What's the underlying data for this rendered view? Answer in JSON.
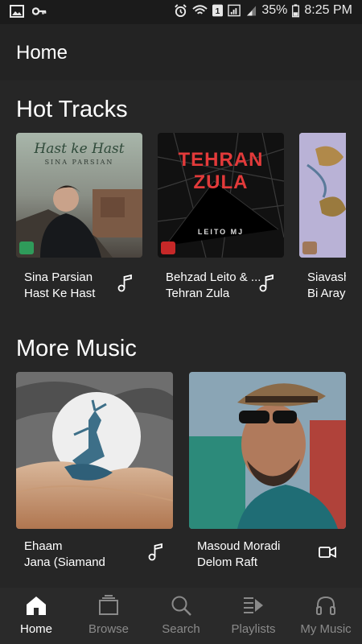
{
  "status_bar": {
    "battery": "35%",
    "time": "8:25 PM"
  },
  "appbar": {
    "title": "Home"
  },
  "sections": {
    "hot_tracks": {
      "title": "Hot Tracks",
      "items": [
        {
          "artist": "Sina Parsian",
          "track": "Hast Ke Hast",
          "art_text": "Hast ke Hast",
          "art_sub": "SINA PARSIAN",
          "type": "music-note-icon"
        },
        {
          "artist": "Behzad Leito & ...",
          "track": "Tehran Zula",
          "art_text": "TEHRAN ZULA",
          "art_sub": "LEITO   MJ",
          "type": "music-note-icon"
        },
        {
          "artist": "Siavash",
          "track": "Bi Arayo",
          "type": "music-note-icon"
        }
      ]
    },
    "more_music": {
      "title": "More Music",
      "items": [
        {
          "artist": "Ehaam",
          "track": "Jana (Siamand",
          "type": "music-note-icon"
        },
        {
          "artist": "Masoud Moradi",
          "track": "Delom Raft",
          "type": "video-icon"
        }
      ]
    }
  },
  "bottom_nav": [
    {
      "label": "Home",
      "icon": "home-icon",
      "active": true
    },
    {
      "label": "Browse",
      "icon": "browse-icon",
      "active": false
    },
    {
      "label": "Search",
      "icon": "search-icon",
      "active": false
    },
    {
      "label": "Playlists",
      "icon": "playlists-icon",
      "active": false
    },
    {
      "label": "My Music",
      "icon": "headphones-icon",
      "active": false
    }
  ],
  "colors": {
    "background": "#262626",
    "appbar": "#232323",
    "nav_active": "#ffffff",
    "nav_inactive": "#8a8a8a"
  }
}
